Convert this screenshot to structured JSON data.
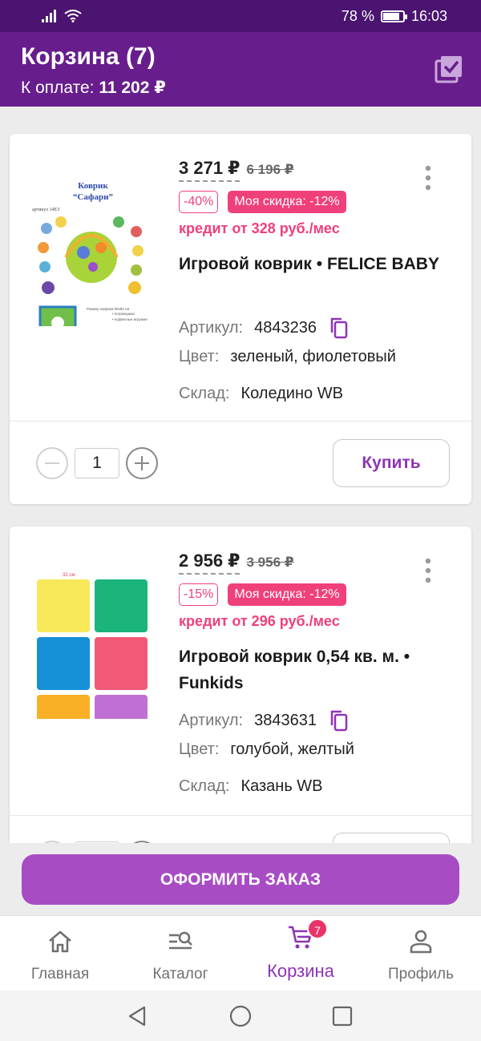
{
  "status": {
    "battery": "78 %",
    "time": "16:03",
    "battery_level": 0.78
  },
  "header": {
    "title": "Корзина (7)",
    "pay_label": "К оплате:",
    "pay_amount": "11 202 ₽"
  },
  "items": [
    {
      "price": "3 271 ₽",
      "old_price": "6 196 ₽",
      "discount": "-40%",
      "my_discount": "Моя скидка: -12%",
      "credit": "кредит от 328 руб./мес",
      "name": "Игровой коврик • FELICE BABY",
      "article_label": "Артикул:",
      "article": "4843236",
      "color_label": "Цвет:",
      "color": "зеленый, фиолетовый",
      "stock_label": "Склад:",
      "stock": "Коледино WB",
      "quantity": "1",
      "buy_label": "Купить",
      "image_title_1": "Коврик",
      "image_title_2": "“Сафари”",
      "image_article": "артикул 14ЕЗ"
    },
    {
      "price": "2 956 ₽",
      "old_price": "3 956 ₽",
      "discount": "-15%",
      "my_discount": "Моя скидка: -12%",
      "credit": "кредит от 296 руб./мес",
      "name": "Игровой коврик 0,54 кв. м. • Funkids",
      "article_label": "Артикул:",
      "article": "3843631",
      "color_label": "Цвет:",
      "color": "голубой, желтый",
      "stock_label": "Склад:",
      "stock": "Казань WB",
      "image_dim": "32 см",
      "tile_colors": [
        "#f7e85a",
        "#1bb47a",
        "#1590d6",
        "#f25a78",
        "#f9b026",
        "#c070d4"
      ]
    }
  ],
  "checkout_label": "ОФОРМИТЬ ЗАКАЗ",
  "nav": {
    "home": "Главная",
    "catalog": "Каталог",
    "cart": "Корзина",
    "cart_count": "7",
    "profile": "Профиль"
  },
  "colors": {
    "status_bar": "#4a1470",
    "header": "#681d8c",
    "accent": "#8e34b5",
    "checkout": "#a84cc4",
    "discount": "#f0407a"
  },
  "icons": [
    "wifi-icon",
    "signal-icon",
    "battery-icon",
    "select-all-icon",
    "more-vert-icon",
    "copy-icon",
    "minus-icon",
    "plus-icon",
    "home-icon",
    "catalog-search-icon",
    "cart-icon",
    "profile-icon",
    "back-icon",
    "home-circle-icon",
    "recents-icon"
  ]
}
